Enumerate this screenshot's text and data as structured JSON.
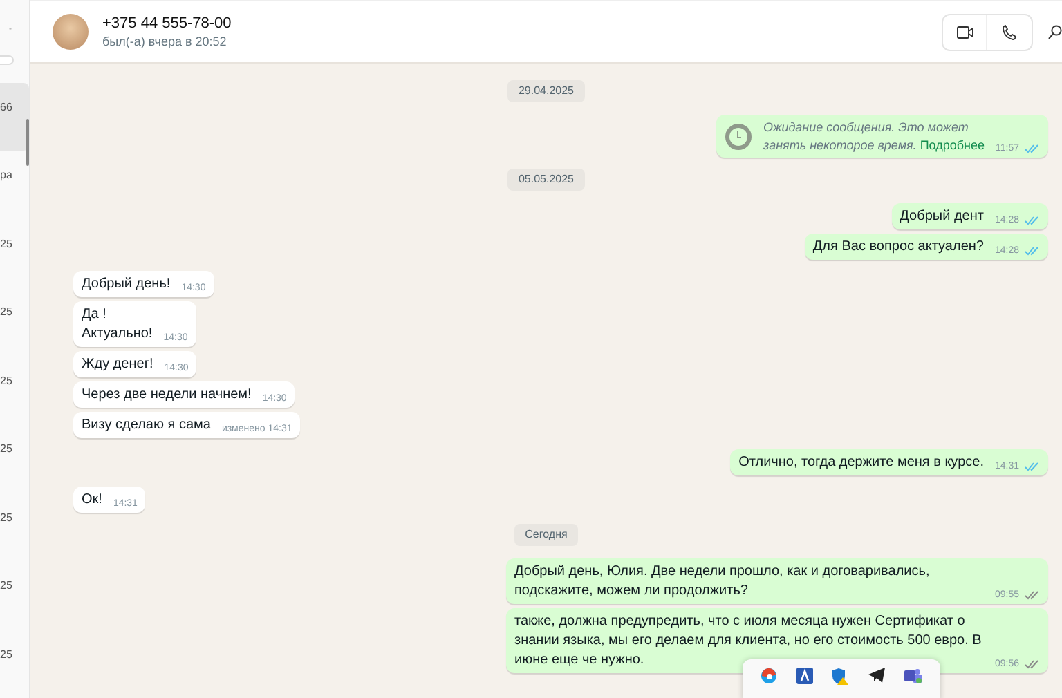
{
  "sidebar": {
    "items": [
      {
        "text": "66",
        "selected": true
      },
      {
        "text": "ра",
        "selected": false
      },
      {
        "text": "25",
        "selected": false
      },
      {
        "text": "25",
        "selected": false
      },
      {
        "text": "25",
        "selected": false
      },
      {
        "text": "25",
        "selected": false
      },
      {
        "text": "25",
        "selected": false
      },
      {
        "text": "25",
        "selected": false
      },
      {
        "text": "25",
        "selected": false
      }
    ]
  },
  "header": {
    "name": "+375 44 555-78-00",
    "status": "был(-а) вчера в 20:52"
  },
  "messages": [
    {
      "kind": "date",
      "text": "29.04.2025"
    },
    {
      "kind": "pending",
      "outgoing": true,
      "text": "Ожидание сообщения. Это может занять некоторое время.",
      "link": "Подробнее",
      "time": "11:57",
      "read": true
    },
    {
      "kind": "date",
      "text": "05.05.2025"
    },
    {
      "kind": "text",
      "outgoing": true,
      "text": "Добрый дент",
      "time": "14:28",
      "read": true
    },
    {
      "kind": "text",
      "outgoing": true,
      "text": "Для Вас вопрос актуален?",
      "time": "14:28",
      "read": true
    },
    {
      "kind": "text",
      "outgoing": false,
      "text": "Добрый день!",
      "time": "14:30"
    },
    {
      "kind": "text",
      "outgoing": false,
      "text": "Да !\nАктуально!",
      "time": "14:30"
    },
    {
      "kind": "text",
      "outgoing": false,
      "text": "Жду денег!",
      "time": "14:30"
    },
    {
      "kind": "text",
      "outgoing": false,
      "text": "Через две недели начнем!",
      "time": "14:30"
    },
    {
      "kind": "text",
      "outgoing": false,
      "text": "Визу сделаю я сама",
      "time": "изменено 14:31"
    },
    {
      "kind": "text",
      "outgoing": true,
      "text": "Отлично, тогда держите меня в курсе.",
      "time": "14:31",
      "read": true
    },
    {
      "kind": "text",
      "outgoing": false,
      "text": "Ок!",
      "time": "14:31"
    },
    {
      "kind": "date",
      "text": "Сегодня"
    },
    {
      "kind": "text",
      "outgoing": true,
      "text": "Добрый день, Юлия. Две недели прошло, как и договаривались, подскажите, можем ли продолжить?",
      "time": "09:55",
      "read": false
    },
    {
      "kind": "text",
      "outgoing": true,
      "text": "также, должна предупредить, что с июля месяца нужен Сертификат о знании языка, мы его делаем для клиента, но его стоимость 500 евро. В июне еще че нужно.",
      "time": "09:56",
      "read": false
    }
  ],
  "tray": {
    "icons": [
      {
        "kind": "browser"
      },
      {
        "kind": "app"
      },
      {
        "kind": "shield"
      },
      {
        "kind": "telegram"
      },
      {
        "kind": "teams"
      }
    ]
  }
}
